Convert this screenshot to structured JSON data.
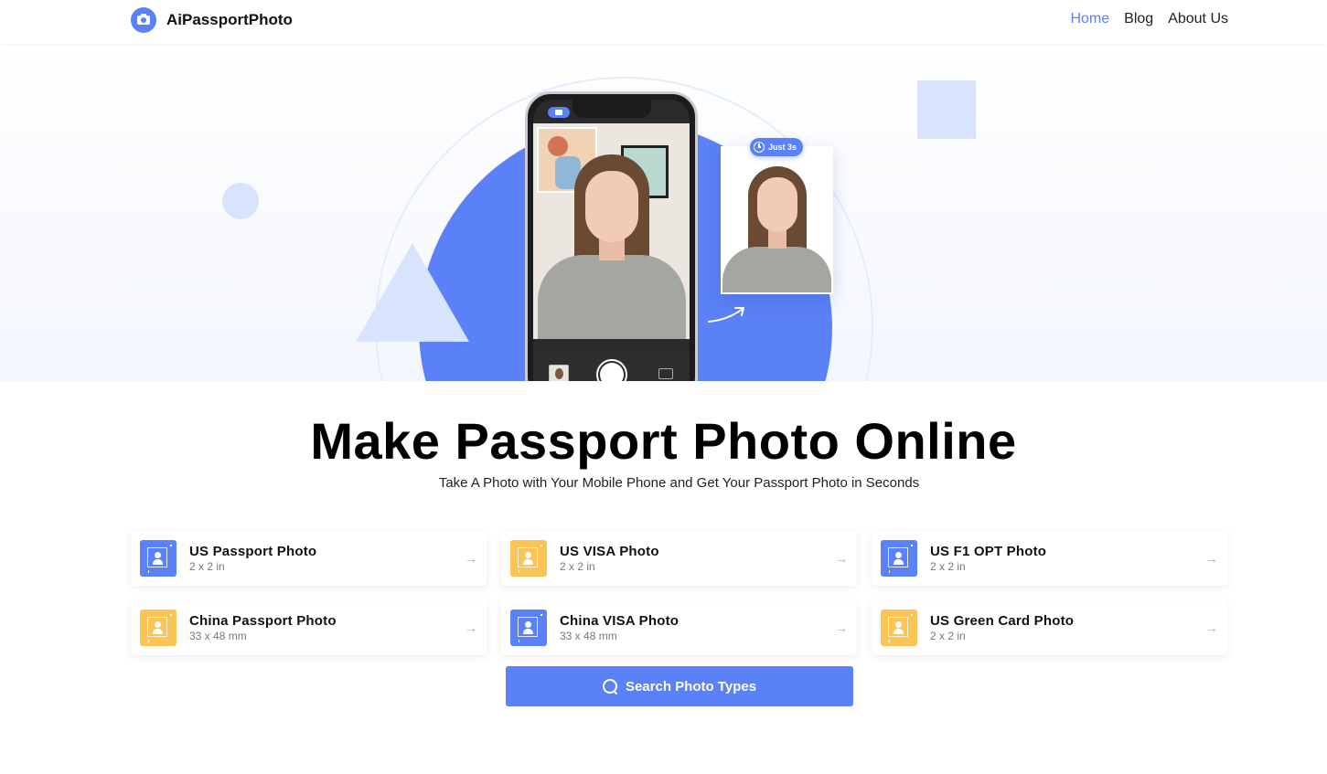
{
  "header": {
    "brand": "AiPassportPhoto",
    "nav": [
      {
        "label": "Home",
        "active": true
      },
      {
        "label": "Blog",
        "active": false
      },
      {
        "label": "About Us",
        "active": false
      }
    ]
  },
  "hero": {
    "badge": "Just 3s",
    "illustration_icons": [
      "camera-icon",
      "clock-icon",
      "shutter-button",
      "flip-camera-icon",
      "curved-arrow-icon"
    ]
  },
  "main": {
    "title": "Make Passport Photo Online",
    "subtitle": "Take A Photo with Your Mobile Phone and Get Your Passport Photo in Seconds"
  },
  "photo_types": [
    {
      "title": "US Passport Photo",
      "size": "2 x 2 in",
      "color": "blue"
    },
    {
      "title": "US VISA Photo",
      "size": "2 x 2 in",
      "color": "yellow"
    },
    {
      "title": "US F1 OPT Photo",
      "size": "2 x 2 in",
      "color": "blue"
    },
    {
      "title": "China Passport Photo",
      "size": "33 x 48 mm",
      "color": "yellow"
    },
    {
      "title": "China VISA Photo",
      "size": "33 x 48 mm",
      "color": "blue"
    },
    {
      "title": "US Green Card Photo",
      "size": "2 x 2 in",
      "color": "yellow"
    }
  ],
  "search_button": {
    "label": "Search Photo Types"
  },
  "colors": {
    "accent": "#5b81f8",
    "yellow": "#fbc454",
    "pale_blue": "#d8e4fd"
  }
}
